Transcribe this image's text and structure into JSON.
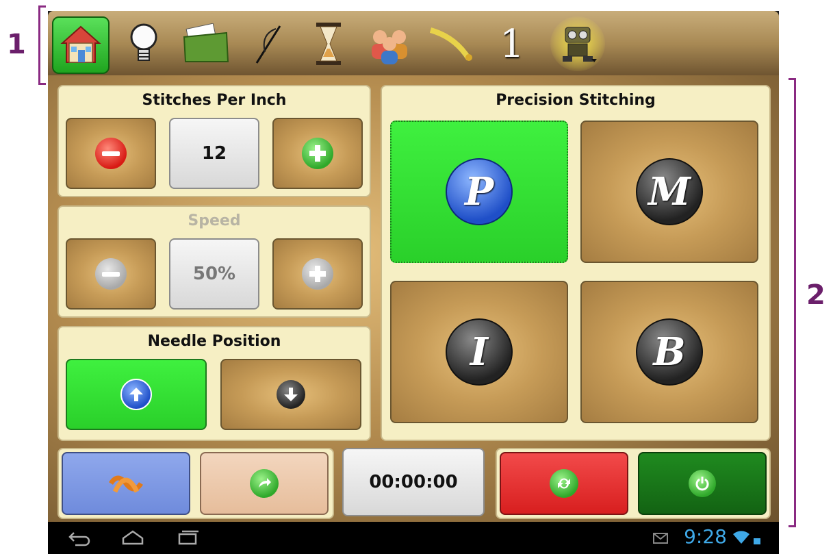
{
  "annotations": {
    "label_1": "1",
    "label_2": "2"
  },
  "toolbar": {
    "icons": [
      "home-icon",
      "lightbulb-icon",
      "folder-icon",
      "needle-icon",
      "hourglass-icon",
      "people-icon",
      "tape-measure-icon",
      "number-one-icon",
      "robot-icon"
    ],
    "number_icon_text": "1"
  },
  "stitches": {
    "title": "Stitches Per Inch",
    "value": "12"
  },
  "speed": {
    "title": "Speed",
    "value": "50%"
  },
  "needle": {
    "title": "Needle Position"
  },
  "precision": {
    "title": "Precision Stitching",
    "modes": [
      "P",
      "M",
      "I",
      "B"
    ],
    "selected": "P"
  },
  "bottom": {
    "timer": "00:00:00"
  },
  "status": {
    "time": "9:28"
  },
  "colors": {
    "selected_green": "#3ff03f",
    "panel_bg": "#f6efc4",
    "clock_blue": "#3fa9e8",
    "annotation_purple": "#6b1f6b"
  }
}
